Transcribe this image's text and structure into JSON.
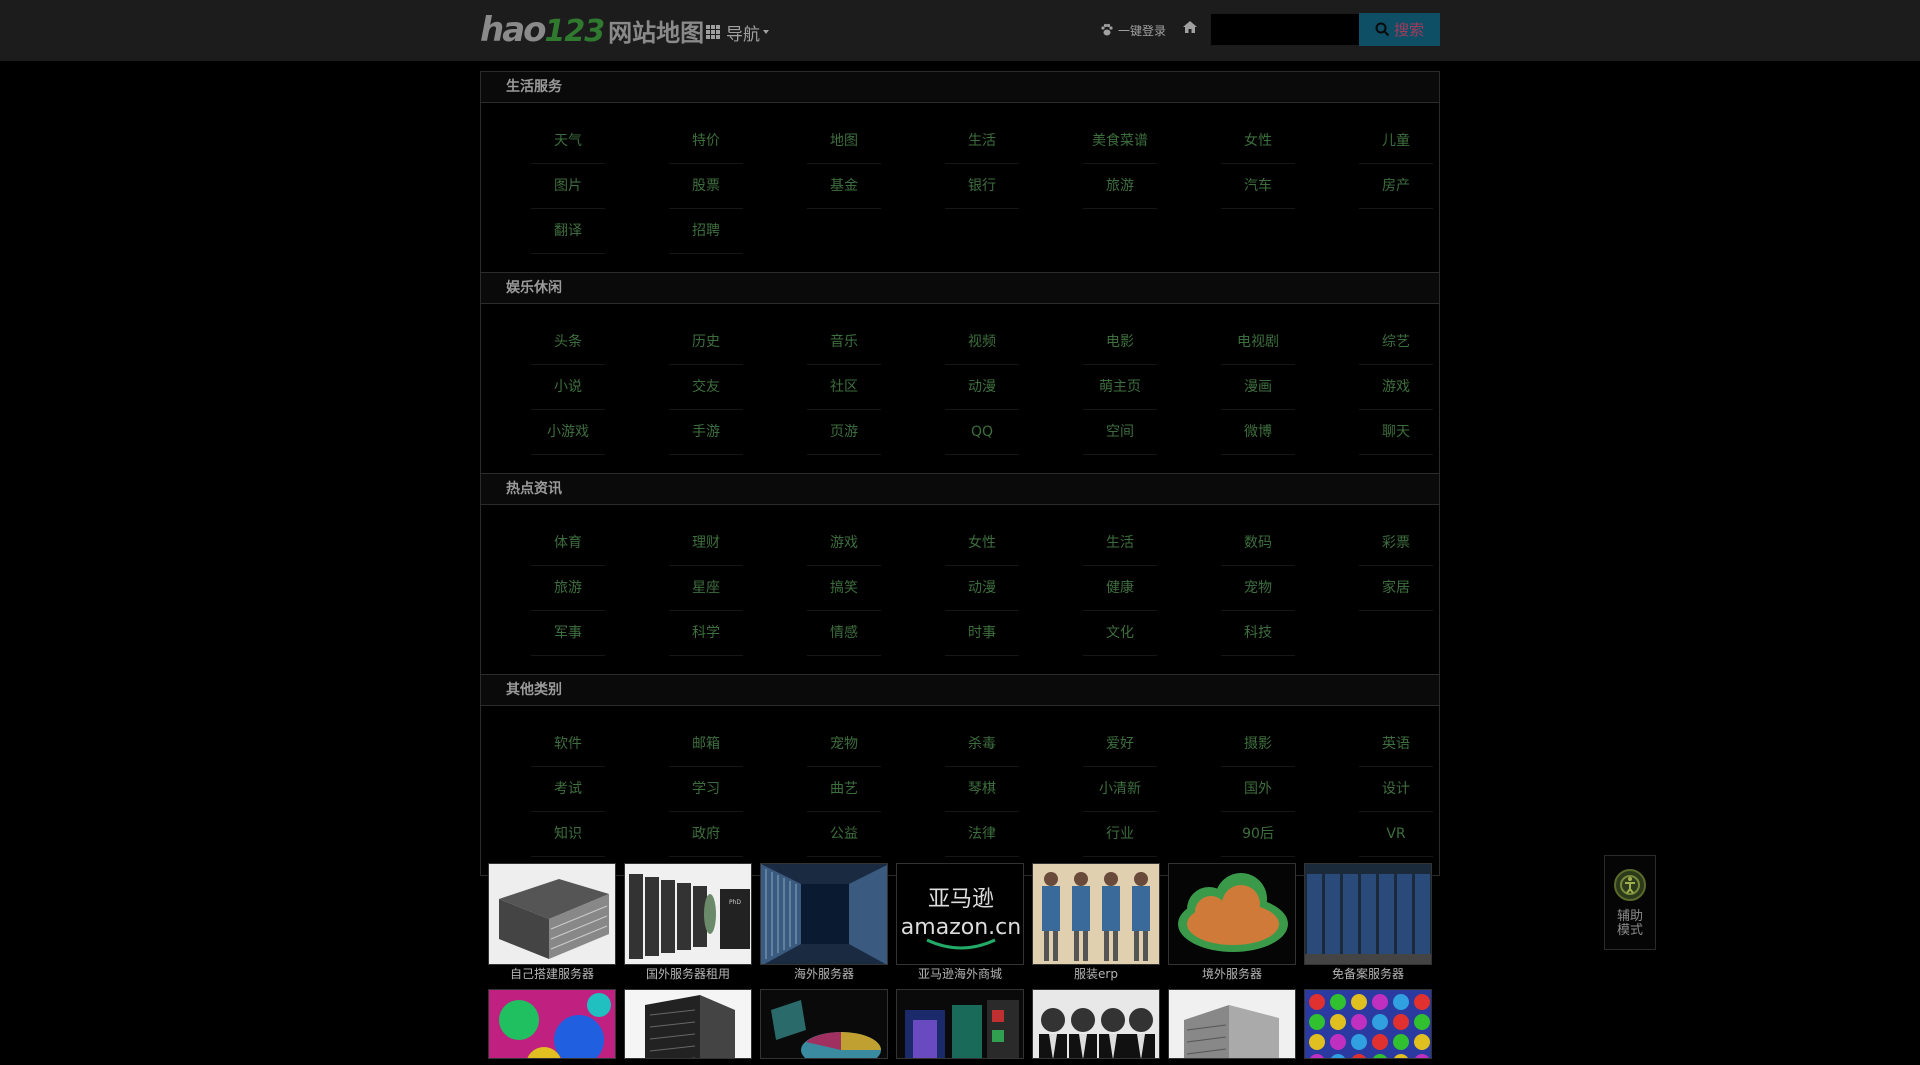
{
  "header": {
    "logo_hao": "hao",
    "logo_123": "123",
    "logo_map": "网站地图",
    "nav_label": "导航",
    "login_label": "一键登录",
    "search_placeholder": "",
    "search_value": "",
    "search_button": "搜索"
  },
  "sections": [
    {
      "title": "生活服务",
      "links": [
        "天气",
        "特价",
        "地图",
        "生活",
        "美食菜谱",
        "女性",
        "儿童",
        "图片",
        "股票",
        "基金",
        "银行",
        "旅游",
        "汽车",
        "房产",
        "翻译",
        "招聘"
      ]
    },
    {
      "title": "娱乐休闲",
      "links": [
        "头条",
        "历史",
        "音乐",
        "视频",
        "电影",
        "电视剧",
        "综艺",
        "小说",
        "交友",
        "社区",
        "动漫",
        "萌主页",
        "漫画",
        "游戏",
        "小游戏",
        "手游",
        "页游",
        "QQ",
        "空间",
        "微博",
        "聊天"
      ]
    },
    {
      "title": "热点资讯",
      "links": [
        "体育",
        "理财",
        "游戏",
        "女性",
        "生活",
        "数码",
        "彩票",
        "旅游",
        "星座",
        "搞笑",
        "动漫",
        "健康",
        "宠物",
        "家居",
        "军事",
        "科学",
        "情感",
        "时事",
        "文化",
        "科技"
      ]
    },
    {
      "title": "其他类别",
      "links": [
        "软件",
        "邮箱",
        "宠物",
        "杀毒",
        "爱好",
        "摄影",
        "英语",
        "考试",
        "学习",
        "曲艺",
        "琴棋",
        "小清新",
        "国外",
        "设计",
        "知识",
        "政府",
        "公益",
        "法律",
        "行业",
        "90后",
        "VR"
      ]
    }
  ],
  "thumbs_row1": [
    {
      "caption": "自己搭建服务器",
      "icon": "server-box"
    },
    {
      "caption": "国外服务器租用",
      "icon": "server-racks"
    },
    {
      "caption": "海外服务器",
      "icon": "datacenter-aisle"
    },
    {
      "caption": "亚马逊海外商城",
      "icon": "amazon-logo",
      "logo_cn": "亚马逊",
      "logo_en": "amazon.cn"
    },
    {
      "caption": "服装erp",
      "icon": "fashion-models"
    },
    {
      "caption": "境外服务器",
      "icon": "cloud"
    },
    {
      "caption": "免备案服务器",
      "icon": "datacenter-racks"
    }
  ],
  "thumbs_row2": [
    {
      "icon": "colorful-pattern"
    },
    {
      "icon": "server-cabinet"
    },
    {
      "icon": "pie-chart-3d"
    },
    {
      "icon": "mobile-apps"
    },
    {
      "icon": "business-people"
    },
    {
      "icon": "server-tower"
    },
    {
      "icon": "gem-game"
    }
  ],
  "assist": {
    "label_line1": "辅助",
    "label_line2": "模式"
  },
  "colors": {
    "topbar": "#1c1c1c",
    "link": "#3d6e3d",
    "search_button_bg": "#0e4f66",
    "logo_123": "#2f7a2f"
  }
}
